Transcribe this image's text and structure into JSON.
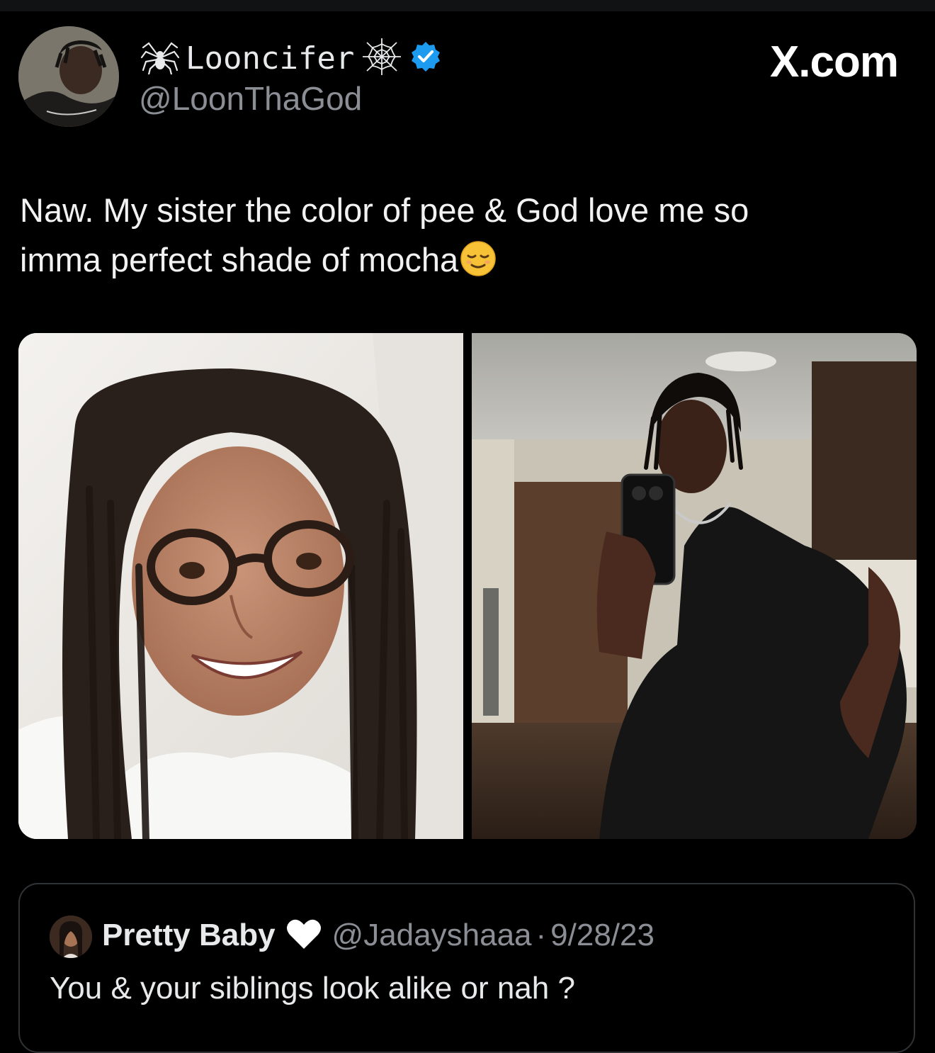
{
  "tweet": {
    "display_name": "Looncifer",
    "handle": "@LoonThaGod",
    "text_line_1": "Naw. My sister the color of pee & God love me so",
    "text_line_2": "imma perfect shade of mocha",
    "emoji": "relieved-face-emoji",
    "badges": [
      "spider-icon",
      "spider-web-icon",
      "verified-badge-icon"
    ],
    "verified_color": "#1d9bf0"
  },
  "watermark": {
    "label": "X.com"
  },
  "media": {
    "count": 2,
    "items": [
      "photo-left",
      "photo-right"
    ]
  },
  "quoted_tweet": {
    "name": "Pretty Baby",
    "name_suffix_icon": "white-heart-icon",
    "handle": "@Jadayshaaa",
    "separator": "·",
    "date": "9/28/23",
    "text": "You & your siblings look alike or nah ?"
  },
  "colors": {
    "background": "#000000",
    "primary_text": "#e7e9ea",
    "secondary_text": "#8b8f95",
    "border": "#2f3336"
  }
}
